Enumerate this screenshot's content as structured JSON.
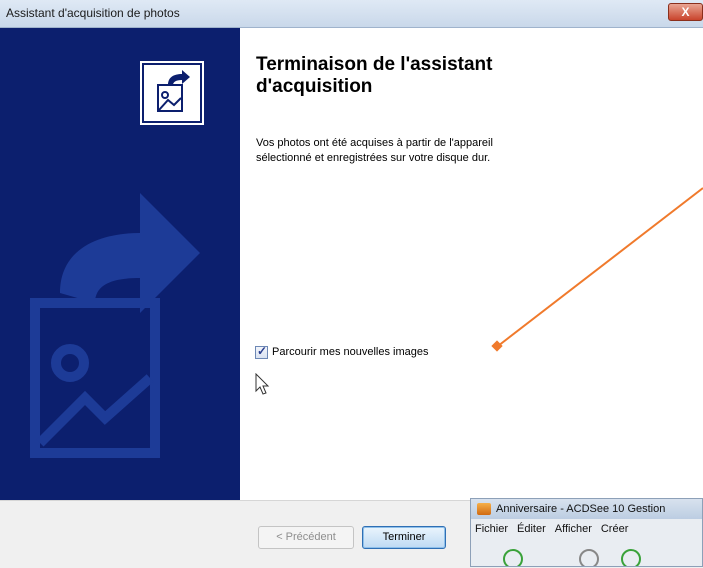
{
  "window": {
    "title": "Assistant d'acquisition de photos",
    "close_glyph": "X"
  },
  "content": {
    "heading_line1": "Terminaison de l'assistant",
    "heading_line2": "d'acquisition",
    "description_line1": "Vos photos ont été acquises à partir de l'appareil",
    "description_line2": "sélectionné et enregistrées sur votre disque dur.",
    "checkbox_label": "Parcourir mes nouvelles images",
    "checkbox_checked": true
  },
  "buttons": {
    "previous": "< Précédent",
    "finish": "Terminer"
  },
  "background_window": {
    "title": "Anniversaire - ACDSee 10 Gestion",
    "menu": [
      "Fichier",
      "Éditer",
      "Afficher",
      "Créer"
    ]
  },
  "colors": {
    "banner": "#0c1f6e",
    "annotation_arrow": "#f07a2c"
  }
}
